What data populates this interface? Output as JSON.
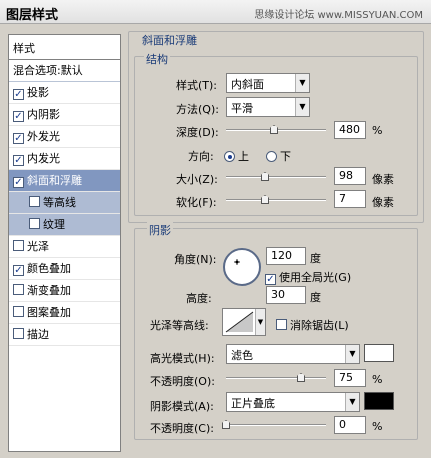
{
  "window": {
    "title": "图层样式",
    "watermark": "思缘设计论坛 www.MISSYUAN.COM"
  },
  "style_list": {
    "header": "样式",
    "blend_options": "混合选项:默认",
    "items": [
      {
        "label": "投影",
        "checked": true
      },
      {
        "label": "内阴影",
        "checked": true
      },
      {
        "label": "外发光",
        "checked": true
      },
      {
        "label": "内发光",
        "checked": true
      },
      {
        "label": "斜面和浮雕",
        "checked": true,
        "selected": true
      },
      {
        "label": "等高线",
        "checked": false,
        "sub": true
      },
      {
        "label": "纹理",
        "checked": false,
        "sub": true
      },
      {
        "label": "光泽",
        "checked": false
      },
      {
        "label": "颜色叠加",
        "checked": true
      },
      {
        "label": "渐变叠加",
        "checked": false
      },
      {
        "label": "图案叠加",
        "checked": false
      },
      {
        "label": "描边",
        "checked": false
      }
    ]
  },
  "bevel": {
    "group_title": "斜面和浮雕",
    "structure_title": "结构",
    "style_label": "样式(T):",
    "style_value": "内斜面",
    "technique_label": "方法(Q):",
    "technique_value": "平滑",
    "depth_label": "深度(D):",
    "depth_value": "480",
    "depth_unit": "%",
    "depth_level": 0.48,
    "direction_label": "方向:",
    "direction_up": "上",
    "direction_down": "下",
    "size_label": "大小(Z):",
    "size_value": "98",
    "size_unit": "像素",
    "size_level": 0.39,
    "soften_label": "软化(F):",
    "soften_value": "7",
    "soften_unit": "像素",
    "soften_level": 0.39
  },
  "shading": {
    "group_title": "阴影",
    "angle_label": "角度(N):",
    "angle_value": "120",
    "angle_unit": "度",
    "global_light_label": "使用全局光(G)",
    "altitude_label": "高度:",
    "altitude_value": "30",
    "altitude_unit": "度",
    "gloss_contour_label": "光泽等高线:",
    "anti_alias_label": "消除锯齿(L)",
    "highlight_mode_label": "高光模式(H):",
    "highlight_mode_value": "滤色",
    "highlight_color": "#ffffff",
    "highlight_opacity_label": "不透明度(O):",
    "highlight_opacity_value": "75",
    "highlight_opacity_level": 0.75,
    "shadow_mode_label": "阴影模式(A):",
    "shadow_mode_value": "正片叠底",
    "shadow_color": "#000000",
    "shadow_opacity_label": "不透明度(C):",
    "shadow_opacity_value": "0",
    "shadow_opacity_level": 0.0,
    "percent_unit": "%"
  }
}
